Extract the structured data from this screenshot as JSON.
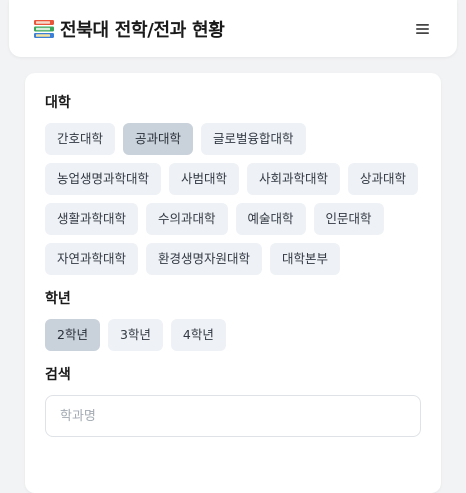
{
  "header": {
    "title": "전북대 전학/전과 현황",
    "logo_icon": "books-icon",
    "menu_icon": "hamburger-menu-icon"
  },
  "college": {
    "label": "대학",
    "options": [
      {
        "label": "간호대학",
        "selected": false
      },
      {
        "label": "공과대학",
        "selected": true
      },
      {
        "label": "글로벌융합대학",
        "selected": false
      },
      {
        "label": "농업생명과학대학",
        "selected": false
      },
      {
        "label": "사범대학",
        "selected": false
      },
      {
        "label": "사회과학대학",
        "selected": false
      },
      {
        "label": "상과대학",
        "selected": false
      },
      {
        "label": "생활과학대학",
        "selected": false
      },
      {
        "label": "수의과대학",
        "selected": false
      },
      {
        "label": "예술대학",
        "selected": false
      },
      {
        "label": "인문대학",
        "selected": false
      },
      {
        "label": "자연과학대학",
        "selected": false
      },
      {
        "label": "환경생명자원대학",
        "selected": false
      },
      {
        "label": "대학본부",
        "selected": false
      }
    ]
  },
  "grade": {
    "label": "학년",
    "options": [
      {
        "label": "2학년",
        "selected": true
      },
      {
        "label": "3학년",
        "selected": false
      },
      {
        "label": "4학년",
        "selected": false
      }
    ]
  },
  "search": {
    "label": "검색",
    "placeholder": "학과명",
    "value": ""
  },
  "colors": {
    "chip_bg": "#eef1f5",
    "chip_selected_bg": "#c9d1da",
    "page_bg": "#f2f3f5"
  }
}
